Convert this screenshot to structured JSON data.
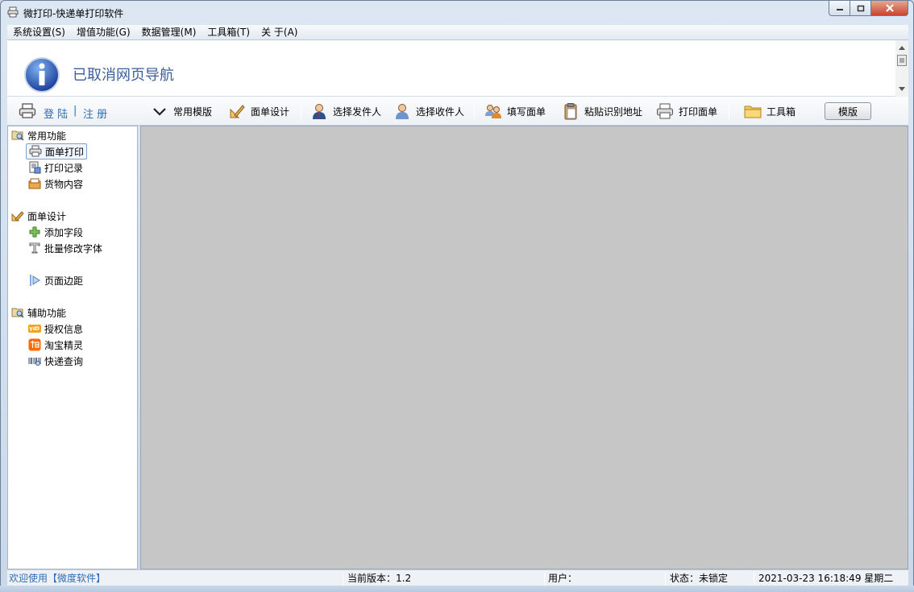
{
  "window": {
    "title": "微打印-快递单打印软件"
  },
  "menu": [
    {
      "label": "系统设置(S)"
    },
    {
      "label": "增值功能(G)"
    },
    {
      "label": "数据管理(M)"
    },
    {
      "label": "工具箱(T)"
    },
    {
      "label": "关  于(A)"
    }
  ],
  "banner": {
    "message": "已取消网页导航"
  },
  "toolbar": {
    "login": "登 陆",
    "separator": "|",
    "register": "注 册",
    "items": [
      {
        "label": "常用模版",
        "icon": "chevron-down-icon"
      },
      {
        "label": "面单设计",
        "icon": "design-ruler-icon"
      },
      {
        "label": "选择发件人",
        "icon": "sender-person-icon"
      },
      {
        "label": "选择收件人",
        "icon": "receiver-person-icon"
      },
      {
        "label": "填写面单",
        "icon": "users-form-icon"
      },
      {
        "label": "粘贴识别地址",
        "icon": "clipboard-icon"
      },
      {
        "label": "打印面单",
        "icon": "printer-icon"
      },
      {
        "label": "工具箱",
        "icon": "folder-icon"
      }
    ],
    "template_button": "模版"
  },
  "sidebar": {
    "groups": [
      {
        "label": "常用功能",
        "items": [
          {
            "label": "面单打印",
            "icon": "printer-icon",
            "selected": true
          },
          {
            "label": "打印记录",
            "icon": "records-icon"
          },
          {
            "label": "货物内容",
            "icon": "goods-icon"
          }
        ]
      },
      {
        "label": "面单设计",
        "items": [
          {
            "label": "添加字段",
            "icon": "plus-icon"
          },
          {
            "label": "批量修改字体",
            "icon": "font-icon"
          },
          {
            "label": "页面边距",
            "icon": "margin-icon"
          }
        ]
      },
      {
        "label": "辅助功能",
        "items": [
          {
            "label": "授权信息",
            "icon": "vip-icon"
          },
          {
            "label": "淘宝精灵",
            "icon": "taobao-icon"
          },
          {
            "label": "快递查询",
            "icon": "barcode-icon"
          }
        ]
      }
    ]
  },
  "status": {
    "welcome": "欢迎使用【微度软件】",
    "version": "当前版本：1.2",
    "user": "用户：",
    "state": "状态：未锁定",
    "datetime": "2021-03-23  16:18:49  星期二"
  },
  "colors": {
    "accent": "#2f6db8",
    "workspace": "#c6c6c6",
    "banner_text": "#3c5f9c"
  }
}
